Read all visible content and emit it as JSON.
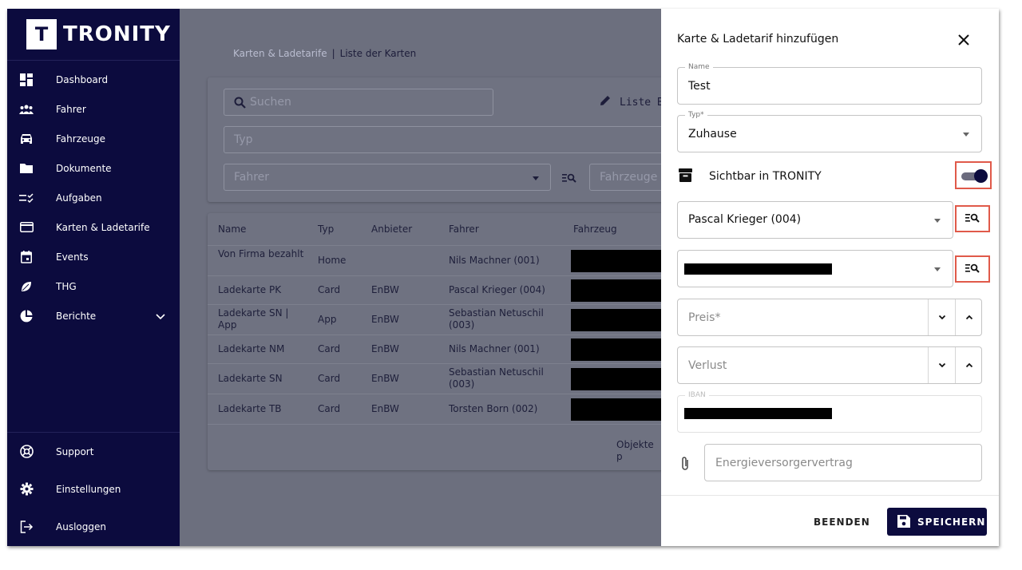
{
  "brand": {
    "logo_letter": "T",
    "name": "TRONITY"
  },
  "sidebar": {
    "items": [
      {
        "label": "Dashboard",
        "icon": "dashboard-icon"
      },
      {
        "label": "Fahrer",
        "icon": "people-icon"
      },
      {
        "label": "Fahrzeuge",
        "icon": "car-icon"
      },
      {
        "label": "Dokumente",
        "icon": "folder-icon"
      },
      {
        "label": "Aufgaben",
        "icon": "tasks-icon"
      },
      {
        "label": "Karten & Ladetarife",
        "icon": "card-icon"
      },
      {
        "label": "Events",
        "icon": "calendar-icon"
      },
      {
        "label": "THG",
        "icon": "leaf-icon"
      },
      {
        "label": "Berichte",
        "icon": "pie-chart-icon"
      }
    ],
    "bottom": [
      {
        "label": "Support",
        "icon": "support-icon"
      },
      {
        "label": "Einstellungen",
        "icon": "gear-icon"
      },
      {
        "label": "Ausloggen",
        "icon": "logout-icon"
      }
    ]
  },
  "breadcrumb": {
    "parent": "Karten & Ladetarife",
    "separator": "|",
    "current": "Liste der Karten"
  },
  "filters": {
    "search_placeholder": "Suchen",
    "edit_list_label": "Liste Be",
    "type_placeholder": "Typ",
    "driver_placeholder": "Fahrer",
    "vehicle_placeholder": "Fahrzeuge"
  },
  "table": {
    "columns": [
      "Name",
      "Typ",
      "Anbieter",
      "Fahrer",
      "Fahrzeug"
    ],
    "rows": [
      {
        "name": "Von Firma bezahlt",
        "type": "Home",
        "provider": "",
        "driver": "Nils Machner (001)"
      },
      {
        "name": "Ladekarte PK",
        "type": "Card",
        "provider": "EnBW",
        "driver": "Pascal Krieger (004)"
      },
      {
        "name": "Ladekarte SN | App",
        "type": "App",
        "provider": "EnBW",
        "driver": "Sebastian Netuschil (003)"
      },
      {
        "name": "Ladekarte NM",
        "type": "Card",
        "provider": "EnBW",
        "driver": "Nils Machner (001)"
      },
      {
        "name": "Ladekarte SN",
        "type": "Card",
        "provider": "EnBW",
        "driver": "Sebastian Netuschil (003)"
      },
      {
        "name": "Ladekarte TB",
        "type": "Card",
        "provider": "EnBW",
        "driver": "Torsten Born (002)"
      }
    ],
    "footer_text": "Objekte p"
  },
  "panel": {
    "title": "Karte & Ladetarif hinzufügen",
    "name_label": "Name",
    "name_value": "Test",
    "type_label": "Typ*",
    "type_value": "Zuhause",
    "visible_label": "Sichtbar in TRONITY",
    "visible_on": true,
    "driver_value": "Pascal Krieger (004)",
    "price_placeholder": "Preis*",
    "loss_placeholder": "Verlust",
    "iban_label": "IBAN",
    "contract_placeholder": "Energieversorgervertrag",
    "cancel_label": "BEENDEN",
    "save_label": "SPEICHERN"
  },
  "colors": {
    "sidebar": "#0c0b3e",
    "overlay": "#6c6f7e",
    "highlight": "#e05a4a"
  }
}
